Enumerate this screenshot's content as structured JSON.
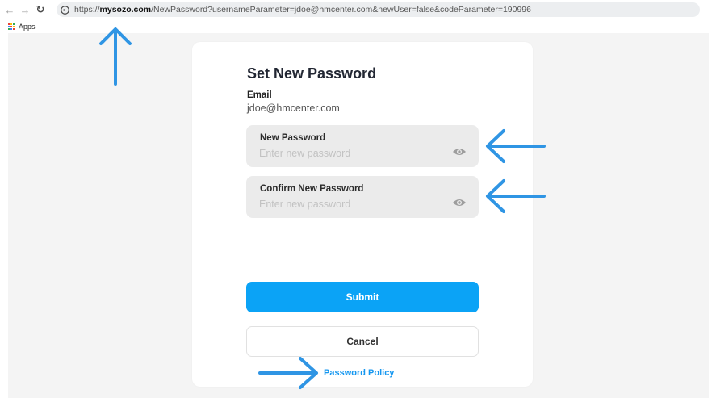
{
  "browser": {
    "url_prefix": "https://",
    "url_domain": "mysozo.com",
    "url_rest": "/NewPassword?usernameParameter=jdoe@hmcenter.com&newUser=false&codeParameter=190996",
    "bookmark_apps": "Apps",
    "icons": {
      "back": "back-arrow-icon",
      "forward": "forward-arrow-icon",
      "reload": "reload-icon",
      "site": "site-info-icon",
      "apps": "apps-grid-icon"
    }
  },
  "form": {
    "title": "Set New Password",
    "email_label": "Email",
    "email_value": "jdoe@hmcenter.com",
    "new_password": {
      "label": "New Password",
      "placeholder": "Enter new password",
      "value": ""
    },
    "confirm_password": {
      "label": "Confirm New Password",
      "placeholder": "Enter new password",
      "value": ""
    },
    "submit_label": "Submit",
    "cancel_label": "Cancel",
    "policy_link": "Password Policy"
  },
  "colors": {
    "accent": "#0ba3f6",
    "link": "#1597f0",
    "annotation_arrow": "#2f95e4",
    "field_bg": "#ebebeb",
    "page_bg": "#f4f4f4"
  }
}
